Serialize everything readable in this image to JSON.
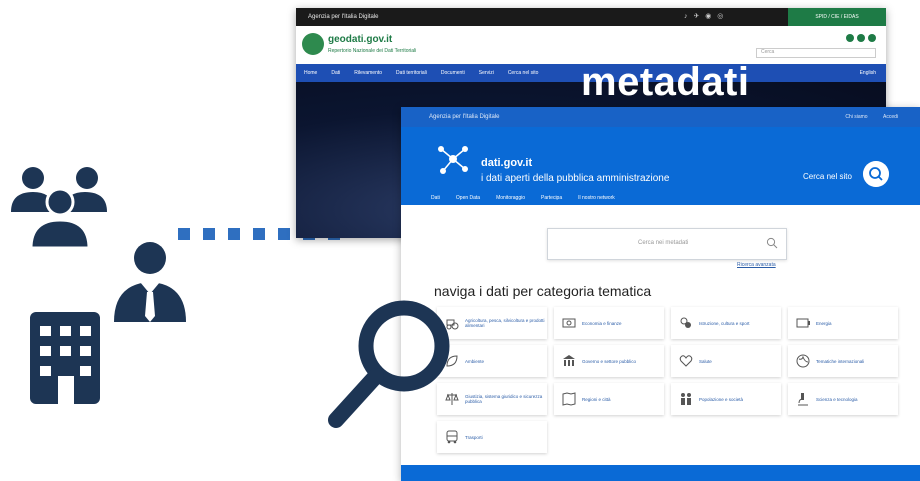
{
  "overlay": {
    "label": "metadati"
  },
  "geodati": {
    "agency": "Agenzia per l'Italia Digitale",
    "login_button": "SPID / CIE / EIDAS",
    "site_name": "geodati.gov.it",
    "subtitle": "Repertorio Nazionale dei Dati Territoriali",
    "search_placeholder": "Cerca",
    "nav": [
      "Home",
      "Dati",
      "Rilevamento",
      "Dati territoriali",
      "Documenti",
      "Servizi",
      "Cerca nel sito"
    ],
    "lang": "English"
  },
  "dati": {
    "agency": "Agenzia per l'Italia Digitale",
    "top_links": [
      "Chi siamo",
      "Accedi"
    ],
    "site_name": "dati.gov.it",
    "tagline": "i dati aperti della pubblica amministrazione",
    "cerca_label": "Cerca nel sito",
    "nav": [
      "Dati",
      "Open Data",
      "Monitoraggio",
      "Partecipa",
      "Il nostro network"
    ],
    "search_placeholder": "Cerca nei metadati",
    "advanced_search": "Ricerca avanzata",
    "heading": "naviga i dati per categoria tematica",
    "categories": [
      {
        "label": "Agricoltura, pesca, silvicoltura e prodotti alimentari",
        "icon": "tractor-icon"
      },
      {
        "label": "Economia e finanze",
        "icon": "money-icon"
      },
      {
        "label": "Istruzione, cultura e sport",
        "icon": "culture-icon"
      },
      {
        "label": "Energia",
        "icon": "energy-icon"
      },
      {
        "label": "Ambiente",
        "icon": "leaf-icon"
      },
      {
        "label": "Governo e settore pubblico",
        "icon": "government-icon"
      },
      {
        "label": "Salute",
        "icon": "heart-icon"
      },
      {
        "label": "Tematiche internazionali",
        "icon": "globe-icon"
      },
      {
        "label": "Giustizia, sistema giuridico e sicurezza pubblica",
        "icon": "scales-icon"
      },
      {
        "label": "Regioni e città",
        "icon": "map-icon"
      },
      {
        "label": "Popolazione e società",
        "icon": "people-icon"
      },
      {
        "label": "Scienza e tecnologia",
        "icon": "microscope-icon"
      },
      {
        "label": "Trasporti",
        "icon": "bus-icon"
      }
    ]
  },
  "colors": {
    "accent": "#0a6ad6",
    "icon_navy": "#1d3554",
    "dots": "#2f6fc0",
    "geo_green": "#1e7b46"
  }
}
